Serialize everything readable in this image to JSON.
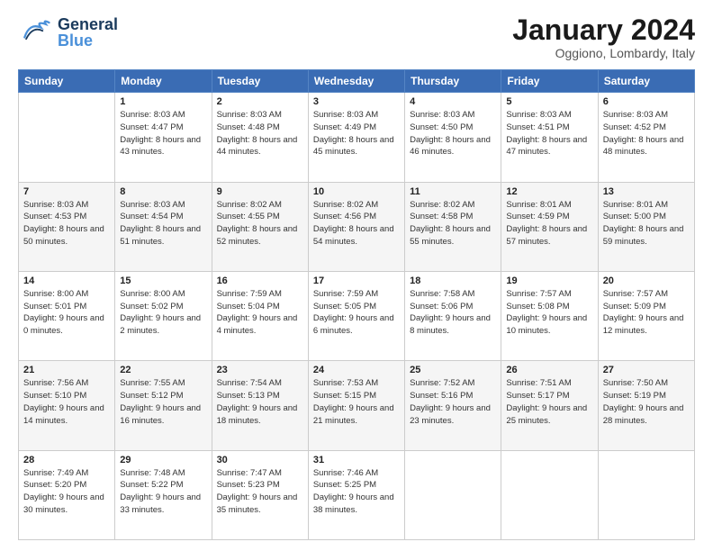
{
  "header": {
    "logo_general": "General",
    "logo_blue": "Blue",
    "main_title": "January 2024",
    "subtitle": "Oggiono, Lombardy, Italy"
  },
  "calendar": {
    "days_of_week": [
      "Sunday",
      "Monday",
      "Tuesday",
      "Wednesday",
      "Thursday",
      "Friday",
      "Saturday"
    ],
    "weeks": [
      [
        {
          "day": "",
          "sunrise": "",
          "sunset": "",
          "daylight": ""
        },
        {
          "day": "1",
          "sunrise": "Sunrise: 8:03 AM",
          "sunset": "Sunset: 4:47 PM",
          "daylight": "Daylight: 8 hours and 43 minutes."
        },
        {
          "day": "2",
          "sunrise": "Sunrise: 8:03 AM",
          "sunset": "Sunset: 4:48 PM",
          "daylight": "Daylight: 8 hours and 44 minutes."
        },
        {
          "day": "3",
          "sunrise": "Sunrise: 8:03 AM",
          "sunset": "Sunset: 4:49 PM",
          "daylight": "Daylight: 8 hours and 45 minutes."
        },
        {
          "day": "4",
          "sunrise": "Sunrise: 8:03 AM",
          "sunset": "Sunset: 4:50 PM",
          "daylight": "Daylight: 8 hours and 46 minutes."
        },
        {
          "day": "5",
          "sunrise": "Sunrise: 8:03 AM",
          "sunset": "Sunset: 4:51 PM",
          "daylight": "Daylight: 8 hours and 47 minutes."
        },
        {
          "day": "6",
          "sunrise": "Sunrise: 8:03 AM",
          "sunset": "Sunset: 4:52 PM",
          "daylight": "Daylight: 8 hours and 48 minutes."
        }
      ],
      [
        {
          "day": "7",
          "sunrise": "Sunrise: 8:03 AM",
          "sunset": "Sunset: 4:53 PM",
          "daylight": "Daylight: 8 hours and 50 minutes."
        },
        {
          "day": "8",
          "sunrise": "Sunrise: 8:03 AM",
          "sunset": "Sunset: 4:54 PM",
          "daylight": "Daylight: 8 hours and 51 minutes."
        },
        {
          "day": "9",
          "sunrise": "Sunrise: 8:02 AM",
          "sunset": "Sunset: 4:55 PM",
          "daylight": "Daylight: 8 hours and 52 minutes."
        },
        {
          "day": "10",
          "sunrise": "Sunrise: 8:02 AM",
          "sunset": "Sunset: 4:56 PM",
          "daylight": "Daylight: 8 hours and 54 minutes."
        },
        {
          "day": "11",
          "sunrise": "Sunrise: 8:02 AM",
          "sunset": "Sunset: 4:58 PM",
          "daylight": "Daylight: 8 hours and 55 minutes."
        },
        {
          "day": "12",
          "sunrise": "Sunrise: 8:01 AM",
          "sunset": "Sunset: 4:59 PM",
          "daylight": "Daylight: 8 hours and 57 minutes."
        },
        {
          "day": "13",
          "sunrise": "Sunrise: 8:01 AM",
          "sunset": "Sunset: 5:00 PM",
          "daylight": "Daylight: 8 hours and 59 minutes."
        }
      ],
      [
        {
          "day": "14",
          "sunrise": "Sunrise: 8:00 AM",
          "sunset": "Sunset: 5:01 PM",
          "daylight": "Daylight: 9 hours and 0 minutes."
        },
        {
          "day": "15",
          "sunrise": "Sunrise: 8:00 AM",
          "sunset": "Sunset: 5:02 PM",
          "daylight": "Daylight: 9 hours and 2 minutes."
        },
        {
          "day": "16",
          "sunrise": "Sunrise: 7:59 AM",
          "sunset": "Sunset: 5:04 PM",
          "daylight": "Daylight: 9 hours and 4 minutes."
        },
        {
          "day": "17",
          "sunrise": "Sunrise: 7:59 AM",
          "sunset": "Sunset: 5:05 PM",
          "daylight": "Daylight: 9 hours and 6 minutes."
        },
        {
          "day": "18",
          "sunrise": "Sunrise: 7:58 AM",
          "sunset": "Sunset: 5:06 PM",
          "daylight": "Daylight: 9 hours and 8 minutes."
        },
        {
          "day": "19",
          "sunrise": "Sunrise: 7:57 AM",
          "sunset": "Sunset: 5:08 PM",
          "daylight": "Daylight: 9 hours and 10 minutes."
        },
        {
          "day": "20",
          "sunrise": "Sunrise: 7:57 AM",
          "sunset": "Sunset: 5:09 PM",
          "daylight": "Daylight: 9 hours and 12 minutes."
        }
      ],
      [
        {
          "day": "21",
          "sunrise": "Sunrise: 7:56 AM",
          "sunset": "Sunset: 5:10 PM",
          "daylight": "Daylight: 9 hours and 14 minutes."
        },
        {
          "day": "22",
          "sunrise": "Sunrise: 7:55 AM",
          "sunset": "Sunset: 5:12 PM",
          "daylight": "Daylight: 9 hours and 16 minutes."
        },
        {
          "day": "23",
          "sunrise": "Sunrise: 7:54 AM",
          "sunset": "Sunset: 5:13 PM",
          "daylight": "Daylight: 9 hours and 18 minutes."
        },
        {
          "day": "24",
          "sunrise": "Sunrise: 7:53 AM",
          "sunset": "Sunset: 5:15 PM",
          "daylight": "Daylight: 9 hours and 21 minutes."
        },
        {
          "day": "25",
          "sunrise": "Sunrise: 7:52 AM",
          "sunset": "Sunset: 5:16 PM",
          "daylight": "Daylight: 9 hours and 23 minutes."
        },
        {
          "day": "26",
          "sunrise": "Sunrise: 7:51 AM",
          "sunset": "Sunset: 5:17 PM",
          "daylight": "Daylight: 9 hours and 25 minutes."
        },
        {
          "day": "27",
          "sunrise": "Sunrise: 7:50 AM",
          "sunset": "Sunset: 5:19 PM",
          "daylight": "Daylight: 9 hours and 28 minutes."
        }
      ],
      [
        {
          "day": "28",
          "sunrise": "Sunrise: 7:49 AM",
          "sunset": "Sunset: 5:20 PM",
          "daylight": "Daylight: 9 hours and 30 minutes."
        },
        {
          "day": "29",
          "sunrise": "Sunrise: 7:48 AM",
          "sunset": "Sunset: 5:22 PM",
          "daylight": "Daylight: 9 hours and 33 minutes."
        },
        {
          "day": "30",
          "sunrise": "Sunrise: 7:47 AM",
          "sunset": "Sunset: 5:23 PM",
          "daylight": "Daylight: 9 hours and 35 minutes."
        },
        {
          "day": "31",
          "sunrise": "Sunrise: 7:46 AM",
          "sunset": "Sunset: 5:25 PM",
          "daylight": "Daylight: 9 hours and 38 minutes."
        },
        {
          "day": "",
          "sunrise": "",
          "sunset": "",
          "daylight": ""
        },
        {
          "day": "",
          "sunrise": "",
          "sunset": "",
          "daylight": ""
        },
        {
          "day": "",
          "sunrise": "",
          "sunset": "",
          "daylight": ""
        }
      ]
    ]
  }
}
